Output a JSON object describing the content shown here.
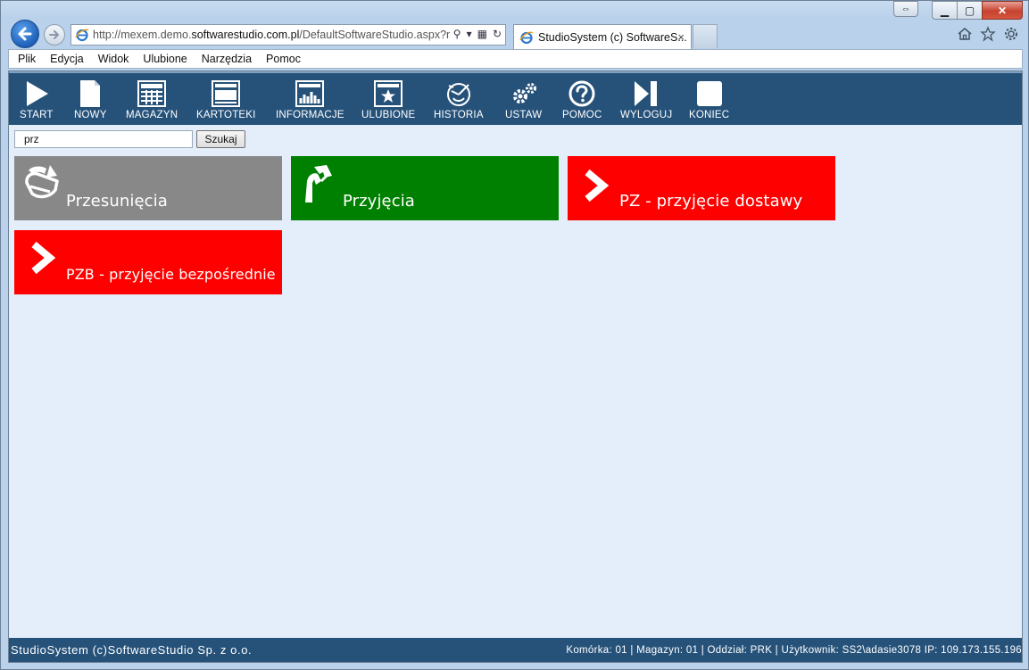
{
  "browser": {
    "address_url_prefix": "http://mexem.demo.",
    "address_url_domain": "softwarestudio.com.pl",
    "address_url_suffix": "/DefaultSoftwareStudio.aspx?r",
    "tab_title": "StudioSystem (c) SoftwareS...",
    "tab_close": "×",
    "menu": [
      "Plik",
      "Edycja",
      "Widok",
      "Ulubione",
      "Narzędzia",
      "Pomoc"
    ]
  },
  "toolbar": {
    "items": [
      {
        "label": "START",
        "icon": "play-icon"
      },
      {
        "label": "NOWY",
        "icon": "new-document-icon"
      },
      {
        "label": "MAGAZYN",
        "icon": "warehouse-grid-icon"
      },
      {
        "label": "KARTOTEKI",
        "icon": "card-file-icon"
      },
      {
        "label": "INFORMACJE",
        "icon": "bar-chart-icon"
      },
      {
        "label": "ULUBIONE",
        "icon": "star-window-icon"
      },
      {
        "label": "HISTORIA",
        "icon": "history-icon"
      },
      {
        "label": "USTAW",
        "icon": "gears-icon"
      },
      {
        "label": "POMOC",
        "icon": "question-icon"
      },
      {
        "label": "WYLOGUJ",
        "icon": "logout-icon"
      },
      {
        "label": "KONIEC",
        "icon": "stop-icon"
      }
    ]
  },
  "search": {
    "value": "prz",
    "button_label": "Szukaj"
  },
  "tiles": [
    {
      "label": "Przesunięcia",
      "color": "#888888",
      "icon": "transfer-icon"
    },
    {
      "label": "Przyjęcia",
      "color": "#008000",
      "icon": "receive-icon"
    },
    {
      "label": "PZ - przyjęcie dostawy",
      "color": "#ff0000",
      "icon": "chevron-right-icon"
    },
    {
      "label": "PZB - przyjęcie bezpośrednie",
      "color": "#ff0000",
      "icon": "chevron-right-icon"
    }
  ],
  "status": {
    "left": "StudioSystem (c)SoftwareStudio Sp. z o.o.",
    "right": "Komórka: 01 | Magazyn: 01 | Oddział: PRK | Użytkownik: SS2\\adasie3078 IP: 109.173.155.196"
  },
  "colors": {
    "toolbar_bg": "#26527a",
    "content_bg": "#e4eefb"
  }
}
